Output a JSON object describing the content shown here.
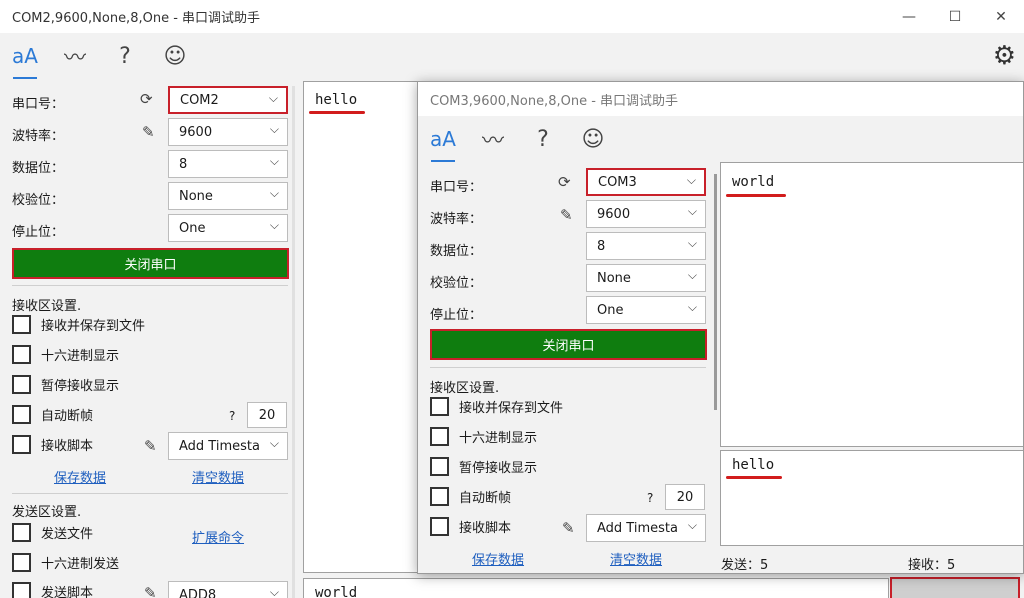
{
  "win1": {
    "title": "COM2,9600,None,8,One - 串口调试助手",
    "controls": {
      "minimize": "—",
      "maximize": "☐",
      "close": "✕"
    },
    "port_label": "串口号：",
    "port_value": "COM2",
    "baud_label": "波特率：",
    "baud_value": "9600",
    "data_label": "数据位：",
    "data_value": "8",
    "parity_label": "校验位：",
    "parity_value": "None",
    "stop_label": "停止位：",
    "stop_value": "One",
    "close_port": "关闭串口",
    "recv_section": "接收区设置.",
    "recv_save_file": "接收并保存到文件",
    "recv_hex": "十六进制显示",
    "recv_pause": "暂停接收显示",
    "auto_frame": "自动断帧",
    "help_q": "?",
    "frame_value": "20",
    "recv_script": "接收脚本",
    "recv_script_value": "Add Timesta",
    "save_data": "保存数据",
    "clear_data": "清空数据",
    "send_section": "发送区设置.",
    "send_file": "发送文件",
    "extend_cmd": "扩展命令",
    "send_hex": "十六进制发送",
    "send_script": "发送脚本",
    "send_script_value": "ADD8",
    "recv_text": "hello",
    "send_text": "world"
  },
  "win2": {
    "title": "COM3,9600,None,8,One - 串口调试助手",
    "port_label": "串口号：",
    "port_value": "COM3",
    "baud_label": "波特率：",
    "baud_value": "9600",
    "data_label": "数据位：",
    "data_value": "8",
    "parity_label": "校验位：",
    "parity_value": "None",
    "stop_label": "停止位：",
    "stop_value": "One",
    "close_port": "关闭串口",
    "recv_section": "接收区设置.",
    "recv_save_file": "接收并保存到文件",
    "recv_hex": "十六进制显示",
    "recv_pause": "暂停接收显示",
    "auto_frame": "自动断帧",
    "help_q": "?",
    "frame_value": "20",
    "recv_script": "接收脚本",
    "recv_script_value": "Add Timesta",
    "save_data": "保存数据",
    "clear_data": "清空数据",
    "recv_text": "world",
    "send_text": "hello",
    "sent_status": "发送：5",
    "recv_status": "接收：5"
  },
  "icons": {
    "font": "aA",
    "chart": "〰",
    "help": "?",
    "smile": "☺",
    "refresh": "⟳",
    "pen": "✎",
    "chevron": "⌵",
    "gear": "⚙"
  },
  "colors": {
    "accent": "#2c7ad6",
    "button_green": "#0f7d0f",
    "highlight_red": "#c8202a"
  }
}
